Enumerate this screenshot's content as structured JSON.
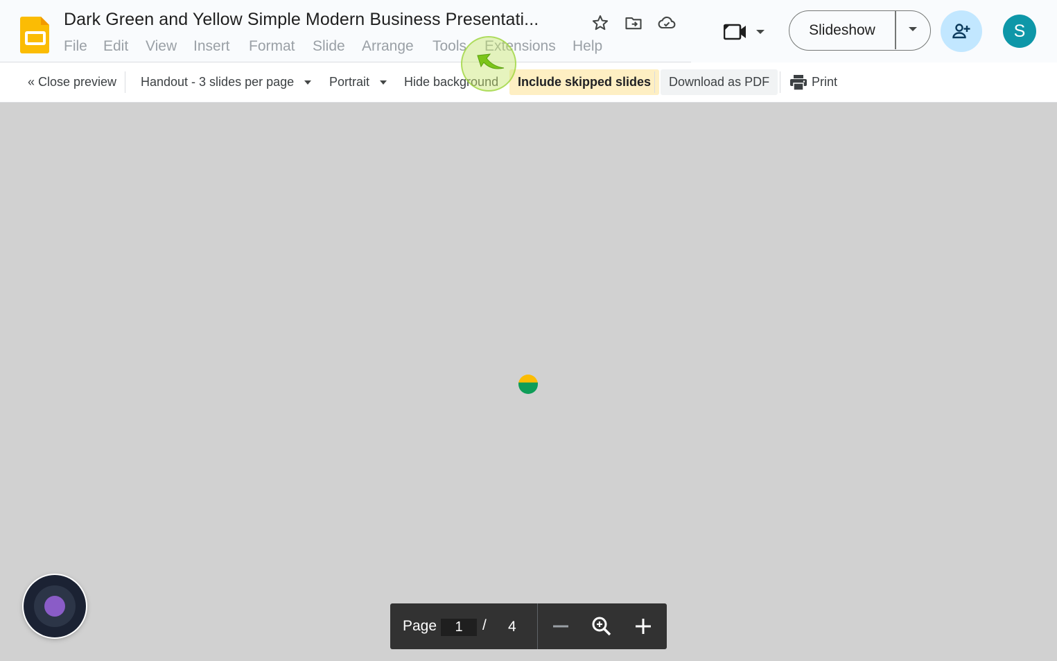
{
  "app": {
    "doc_title": "Dark Green and Yellow Simple Modern Business Presentati...",
    "logo_icon": "google-slides-icon",
    "brand_color": "#fbbc04"
  },
  "title_actions": [
    {
      "icon": "star-icon",
      "name": "star-button"
    },
    {
      "icon": "move-to-folder-icon",
      "name": "move-button"
    },
    {
      "icon": "cloud-saved-icon",
      "name": "document-status-button"
    }
  ],
  "menu": [
    "File",
    "Edit",
    "View",
    "Insert",
    "Format",
    "Slide",
    "Arrange",
    "Tools",
    "Extensions",
    "Help"
  ],
  "header_right": {
    "meet_icon": "video-camera-icon",
    "slideshow_label": "Slideshow",
    "share_icon": "person-add-icon",
    "avatar_letter": "S",
    "avatar_color": "#0e97a8"
  },
  "print_toolbar": {
    "close_preview": "« Close preview",
    "layout_option": "Handout - 3 slides per page",
    "orientation_option": "Portrait",
    "hide_background": "Hide background",
    "include_skipped": "Include skipped slides",
    "download_pdf": "Download as PDF",
    "print": "Print",
    "active_highlight": "#feefc3"
  },
  "page_nav": {
    "label": "Page",
    "current_page": "1",
    "separator": "/",
    "total_pages": "4"
  }
}
